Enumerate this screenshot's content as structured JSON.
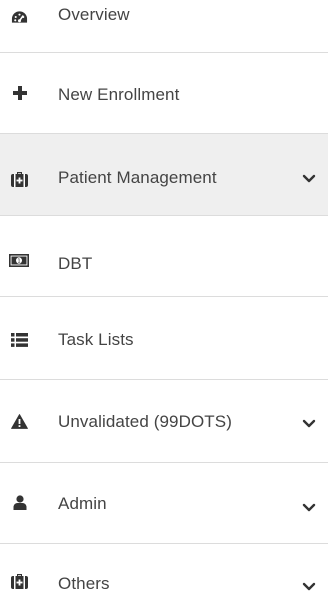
{
  "sidebar": {
    "active_item": "Patient Management",
    "items": [
      {
        "label": "Overview",
        "icon": "dashboard-icon",
        "has_submenu": false
      },
      {
        "label": "New Enrollment",
        "icon": "plus-icon",
        "has_submenu": false
      },
      {
        "label": "Patient Management",
        "icon": "medkit-icon",
        "has_submenu": true
      },
      {
        "label": "DBT",
        "icon": "money-icon",
        "has_submenu": false
      },
      {
        "label": "Task Lists",
        "icon": "list-icon",
        "has_submenu": false
      },
      {
        "label": "Unvalidated (99DOTS)",
        "icon": "warning-icon",
        "has_submenu": true
      },
      {
        "label": "Admin",
        "icon": "user-icon",
        "has_submenu": true
      },
      {
        "label": "Others",
        "icon": "medkit-icon",
        "has_submenu": true
      }
    ]
  },
  "colors": {
    "text": "#444444",
    "icon": "#333333",
    "active_bg": "#efefef",
    "divider": "#dcdcdc"
  }
}
